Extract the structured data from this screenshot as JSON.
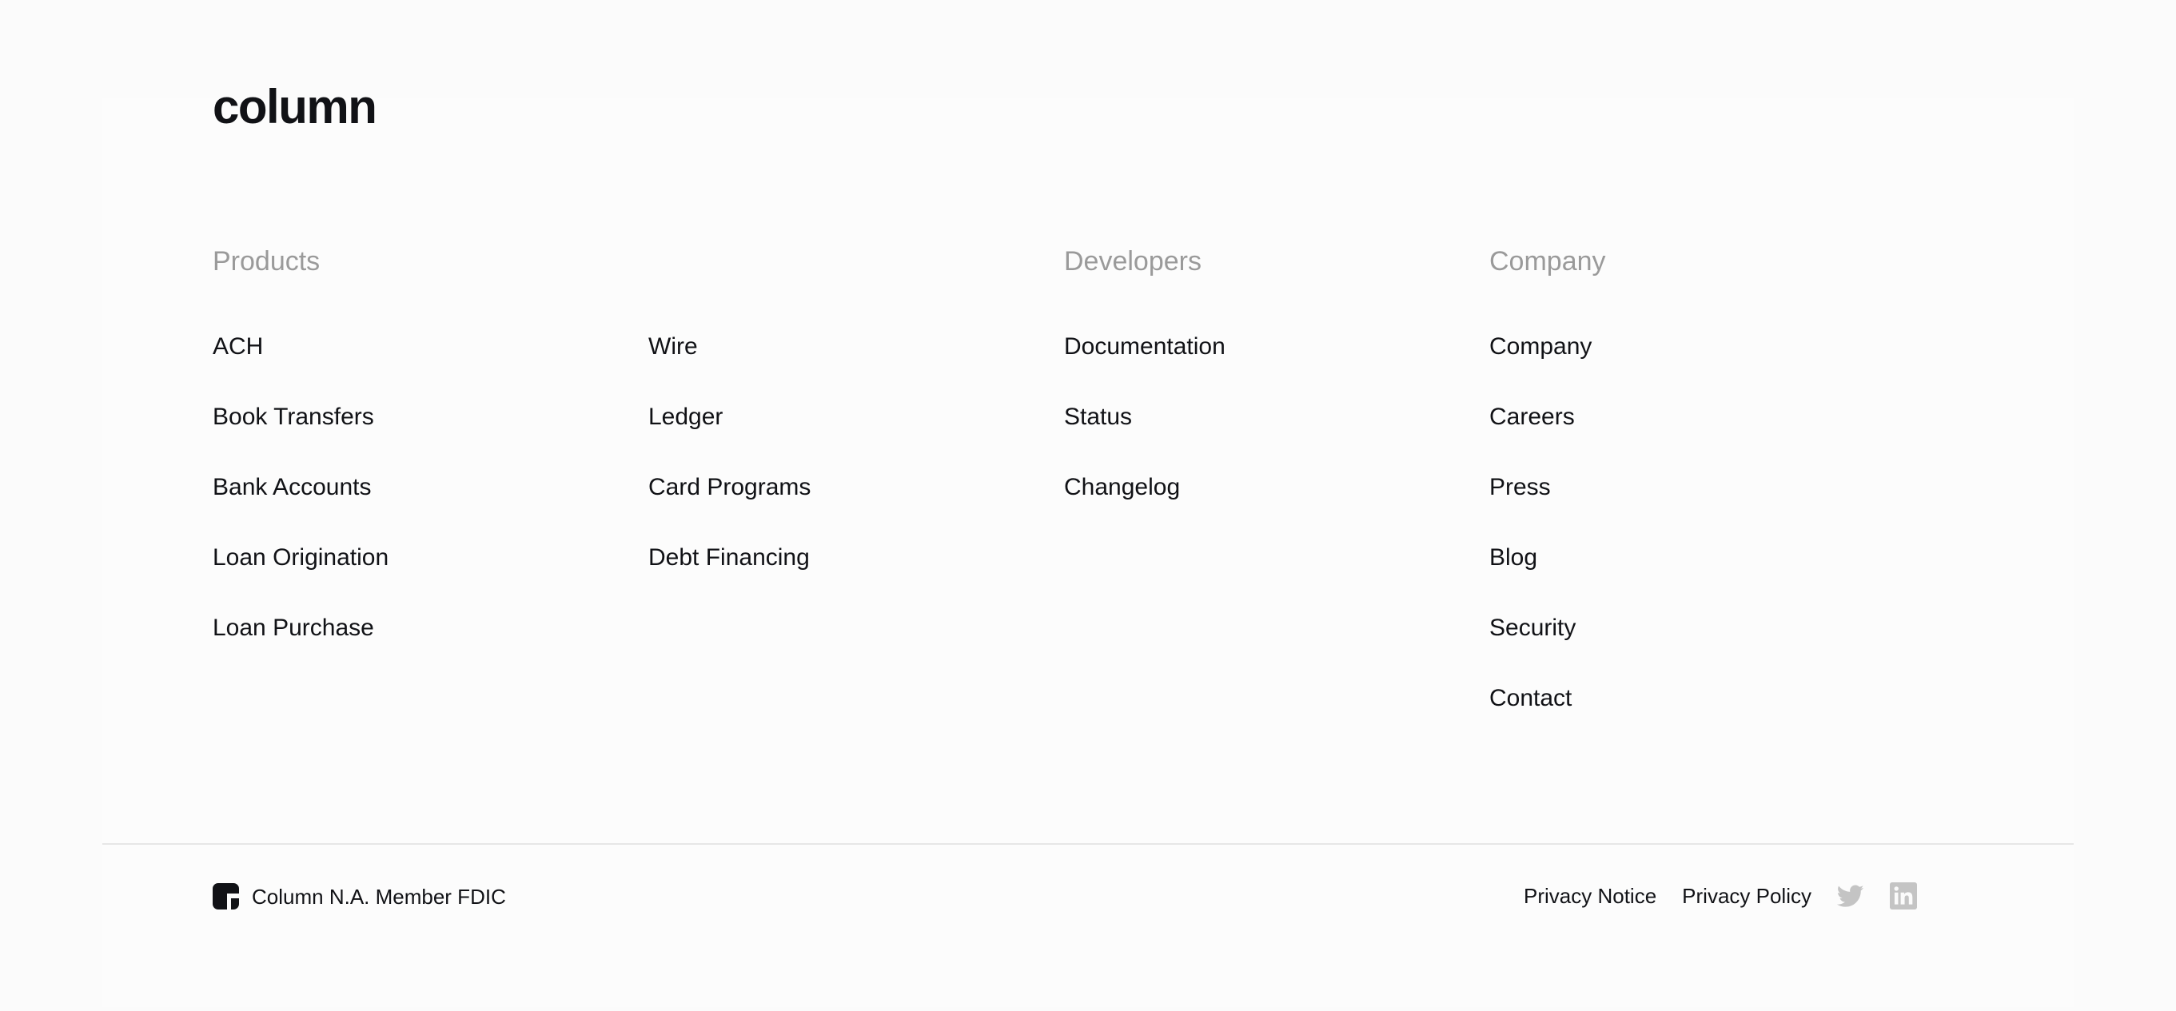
{
  "brand": {
    "logo_text": "column"
  },
  "columns": {
    "products": {
      "heading": "Products",
      "left_links": [
        "ACH",
        "Book Transfers",
        "Bank Accounts",
        "Loan Origination",
        "Loan Purchase"
      ],
      "right_links": [
        "Wire",
        "Ledger",
        "Card Programs",
        "Debt Financing"
      ]
    },
    "developers": {
      "heading": "Developers",
      "links": [
        "Documentation",
        "Status",
        "Changelog"
      ]
    },
    "company": {
      "heading": "Company",
      "links": [
        "Company",
        "Careers",
        "Press",
        "Blog",
        "Security",
        "Contact"
      ]
    }
  },
  "bottom_bar": {
    "bank_text": "Column N.A. Member FDIC",
    "privacy_notice": "Privacy Notice",
    "privacy_policy": "Privacy Policy",
    "social_icons": [
      "twitter-icon",
      "linkedin-icon"
    ]
  },
  "colors": {
    "text": "#111216",
    "heading_muted": "#9a9a9a",
    "icon_muted": "#c4c4c4",
    "background": "#fbfbfb",
    "divider": "#e6e6e6"
  }
}
